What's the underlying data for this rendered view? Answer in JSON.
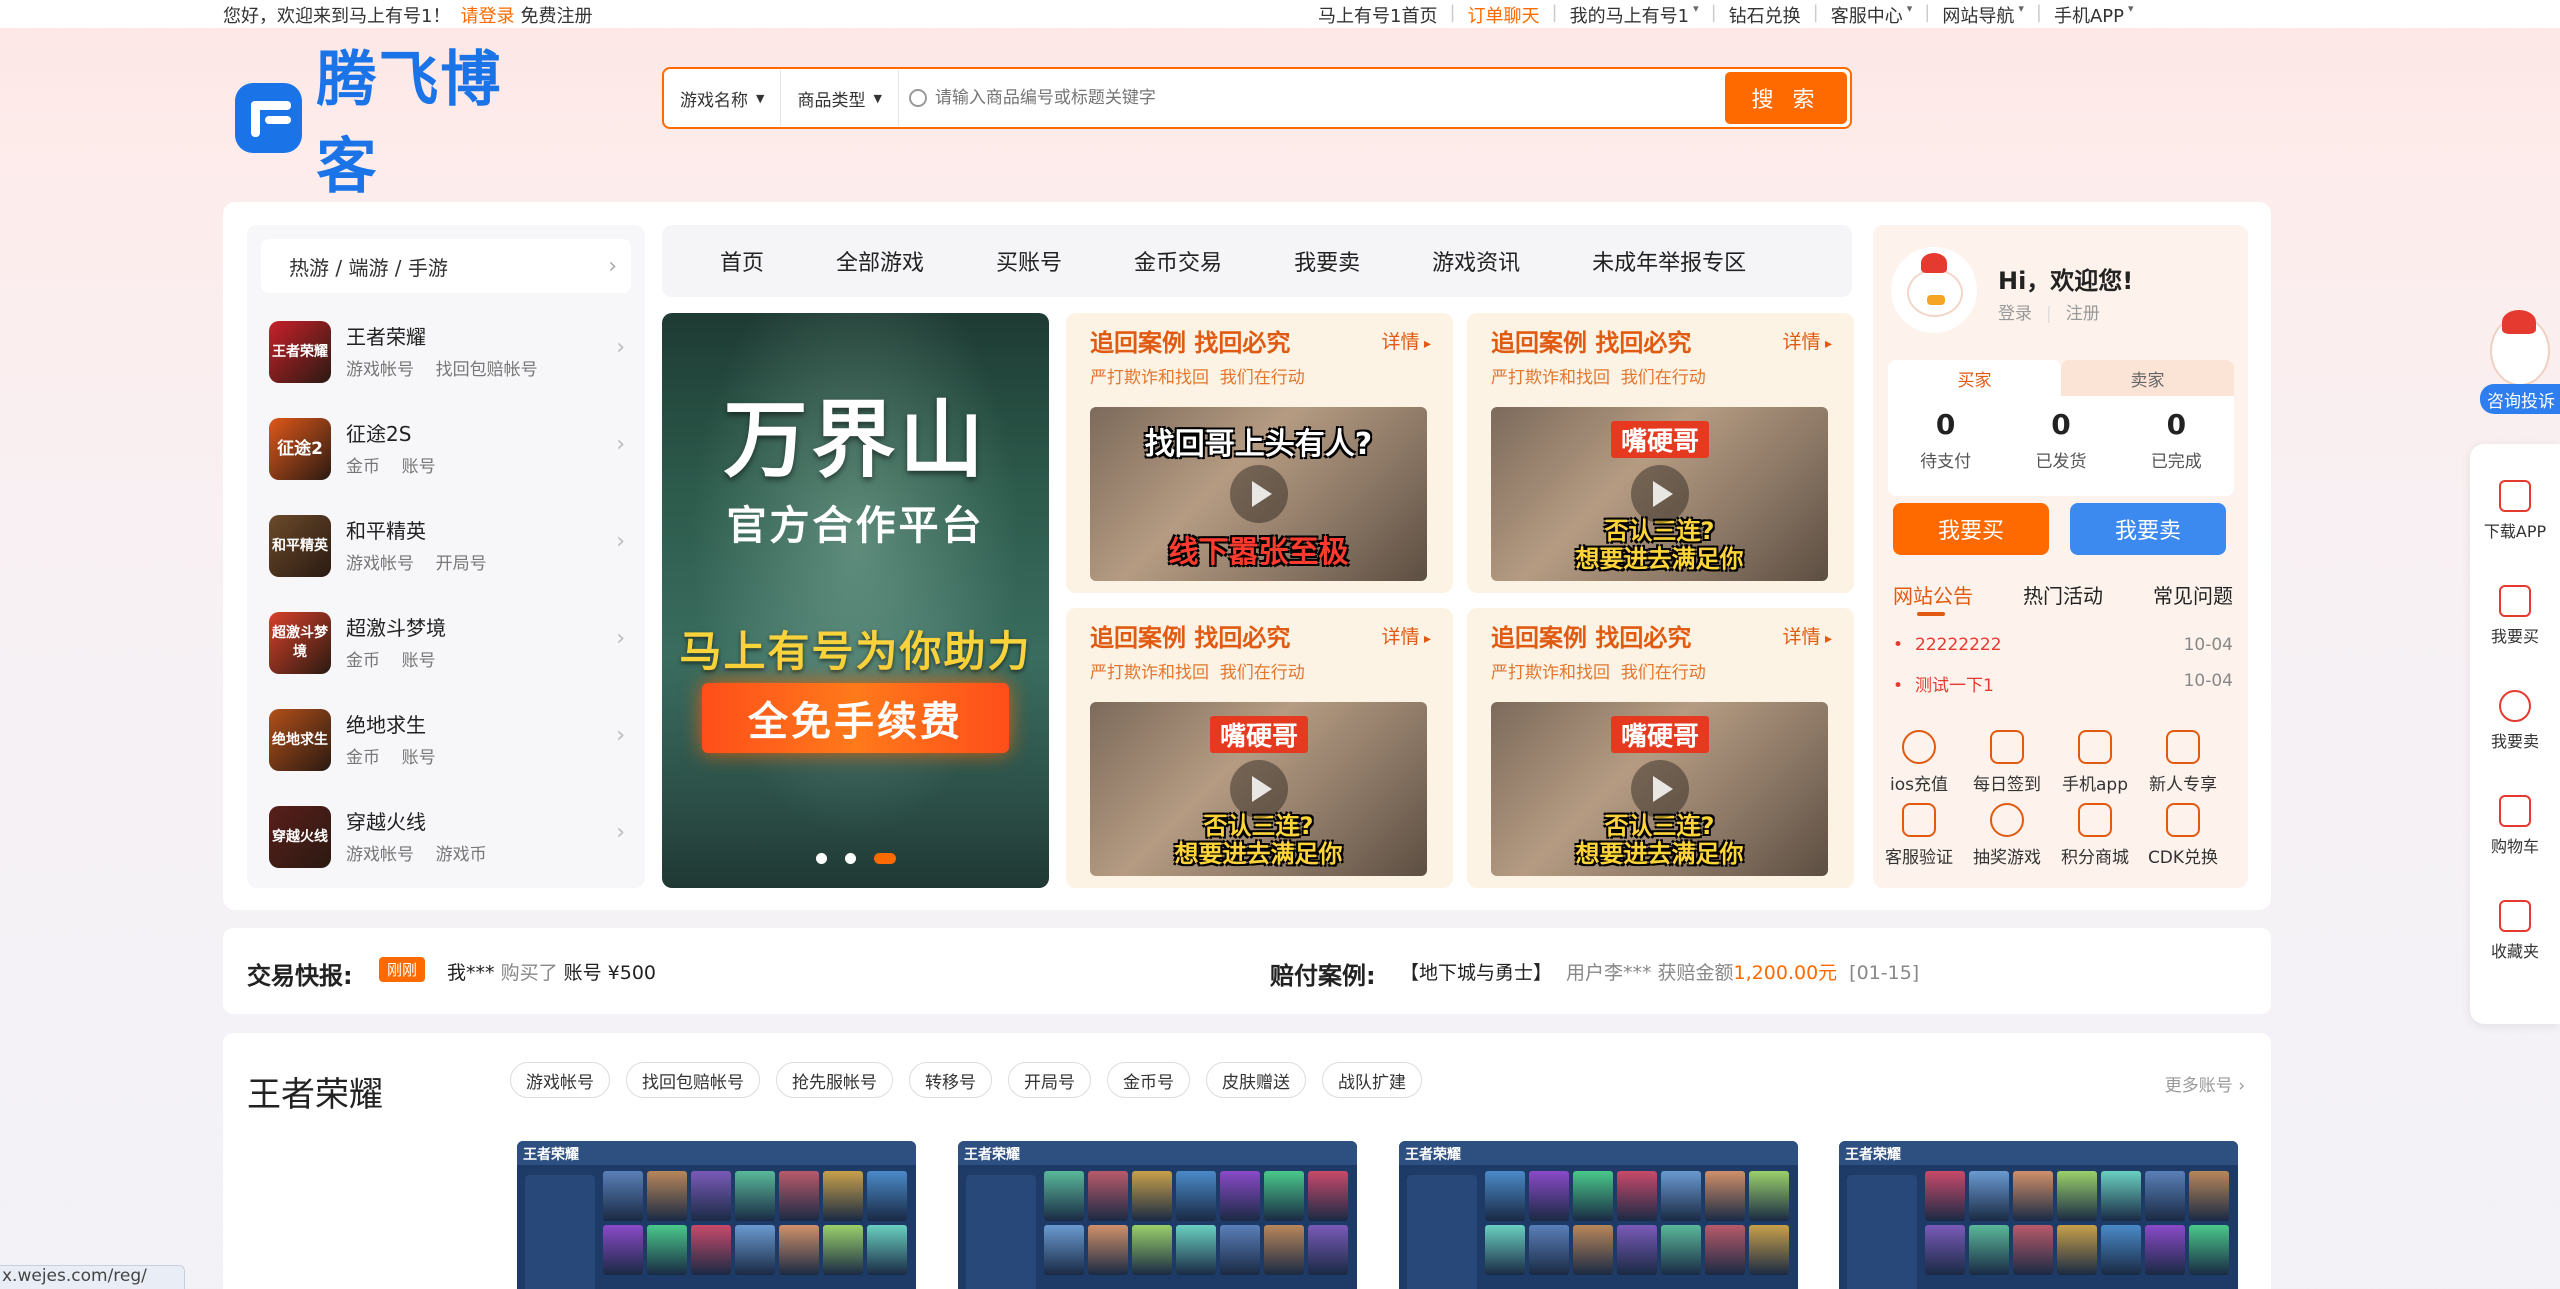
{
  "topbar": {
    "welcome": "您好，欢迎来到马上有号1！",
    "login": "请登录",
    "register": "免费注册",
    "links": [
      {
        "label": "马上有号1首页",
        "dropdown": false,
        "highlight": false
      },
      {
        "label": "订单聊天",
        "dropdown": false,
        "highlight": true
      },
      {
        "label": "我的马上有号1",
        "dropdown": true,
        "highlight": false
      },
      {
        "label": "钻石兑换",
        "dropdown": false,
        "highlight": false
      },
      {
        "label": "客服中心",
        "dropdown": true,
        "highlight": false
      },
      {
        "label": "网站导航",
        "dropdown": true,
        "highlight": false
      },
      {
        "label": "手机APP",
        "dropdown": true,
        "highlight": false
      }
    ]
  },
  "logo": {
    "text": "腾飞博客"
  },
  "search": {
    "select1": "游戏名称",
    "select2": "商品类型",
    "placeholder": "请输入商品编号或标题关键字",
    "button": "搜 索"
  },
  "categories": {
    "header": "热游 / 端游 / 手游",
    "items": [
      {
        "name": "王者荣耀",
        "sub": "游戏帐号    找回包赔帐号",
        "icon_text": "王者荣耀",
        "color": "#c8202a"
      },
      {
        "name": "征途2S",
        "sub": "金币    账号",
        "icon_text": "征途2",
        "color": "#e0581a"
      },
      {
        "name": "和平精英",
        "sub": "游戏帐号    开局号",
        "icon_text": "和平精英",
        "color": "#6b4a2a"
      },
      {
        "name": "超激斗梦境",
        "sub": "金币    账号",
        "icon_text": "超激斗梦境",
        "color": "#d8402a"
      },
      {
        "name": "绝地求生",
        "sub": "金币    账号",
        "icon_text": "绝地求生",
        "color": "#b2501a"
      },
      {
        "name": "穿越火线",
        "sub": "游戏帐号    游戏币",
        "icon_text": "穿越火线",
        "color": "#5a1e1a"
      }
    ]
  },
  "mainnav": [
    "首页",
    "全部游戏",
    "买账号",
    "金币交易",
    "我要卖",
    "游戏资讯",
    "未成年举报专区"
  ],
  "banner": {
    "title": "万界山",
    "subtitle": "官方合作平台",
    "slogan": "马上有号为你助力",
    "badge": "全免手续费"
  },
  "cases": [
    {
      "title": "追回案例 找回必究",
      "sub": "严打欺诈和找回  我们在行动",
      "more": "详情",
      "cap_top": "找回哥上头有人?",
      "cap_bottom": "线下嚣张至极",
      "style": "a"
    },
    {
      "title": "追回案例 找回必究",
      "sub": "严打欺诈和找回  我们在行动",
      "more": "详情",
      "cap_top": "嘴硬哥",
      "cap_bottom": "否认三连?\n想要进去满足你",
      "style": "b"
    },
    {
      "title": "追回案例 找回必究",
      "sub": "严打欺诈和找回  我们在行动",
      "more": "详情",
      "cap_top": "嘴硬哥",
      "cap_bottom": "否认三连?\n想要进去满足你",
      "style": "b"
    },
    {
      "title": "追回案例 找回必究",
      "sub": "严打欺诈和找回  我们在行动",
      "more": "详情",
      "cap_top": "嘴硬哥",
      "cap_bottom": "否认三连?\n想要进去满足你",
      "style": "b"
    }
  ],
  "user": {
    "greeting": "Hi，欢迎您!",
    "login": "登录",
    "register": "注册",
    "tab_buyer": "买家",
    "tab_seller": "卖家",
    "stats": [
      {
        "value": "0",
        "label": "待支付"
      },
      {
        "value": "0",
        "label": "已发货"
      },
      {
        "value": "0",
        "label": "已完成"
      }
    ],
    "buy_button": "我要买",
    "sell_button": "我要卖",
    "notice_tabs": [
      "网站公告",
      "热门活动",
      "常见问题"
    ],
    "notices": [
      {
        "title": "22222222",
        "date": "10-04"
      },
      {
        "title": "测试一下1",
        "date": "10-04"
      }
    ],
    "quick": [
      {
        "label": "ios充值",
        "icon": "apple-icon"
      },
      {
        "label": "每日签到",
        "icon": "calendar-icon"
      },
      {
        "label": "手机app",
        "icon": "app-icon"
      },
      {
        "label": "新人专享",
        "icon": "gift-icon"
      },
      {
        "label": "客服验证",
        "icon": "headset-icon"
      },
      {
        "label": "抽奖游戏",
        "icon": "lottery-icon"
      },
      {
        "label": "积分商城",
        "icon": "shop-icon"
      },
      {
        "label": "CDK兑换",
        "icon": "exchange-icon"
      }
    ]
  },
  "ticker": {
    "label": "交易快报:",
    "tag": "刚刚",
    "user": "我***",
    "action": "购买了",
    "item": "账号 ¥500",
    "comp_label": "赔付案例:",
    "comp_game": "【地下城与勇士】",
    "comp_user": "用户李***",
    "comp_text": "获赔金额",
    "comp_amount": "1,200.00元",
    "comp_date": "[01-15]"
  },
  "gamesection": {
    "title": "王者荣耀",
    "chips": [
      "游戏帐号",
      "找回包赔帐号",
      "抢先服帐号",
      "转移号",
      "开局号",
      "金币号",
      "皮肤赠送",
      "战队扩建"
    ],
    "more": "更多账号",
    "thumb_logo": "王者荣耀"
  },
  "float": {
    "kefu": "咨询投诉",
    "items": [
      "下载APP",
      "我要买",
      "我要卖",
      "购物车",
      "收藏夹"
    ]
  },
  "status_url": "x.wejes.com/reg/"
}
